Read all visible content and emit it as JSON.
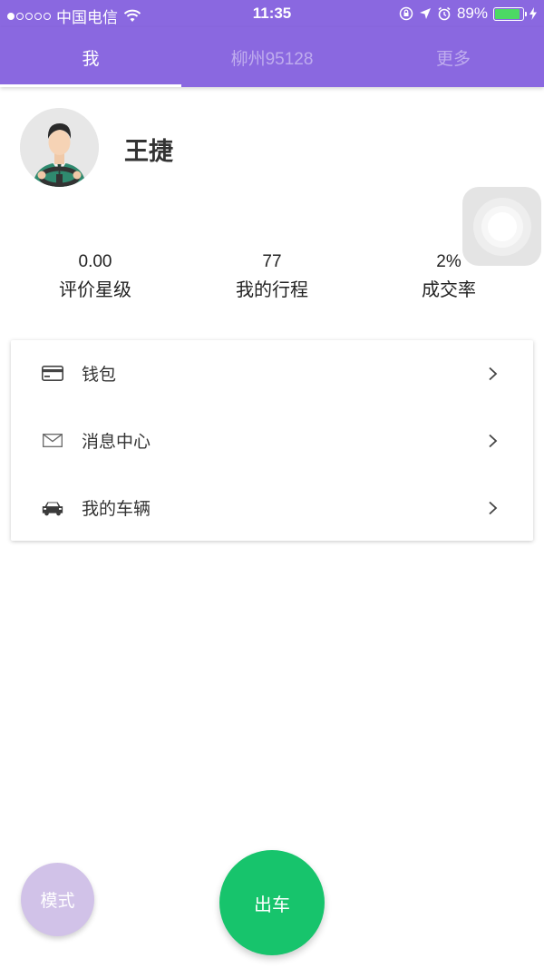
{
  "status_bar": {
    "carrier": "中国电信",
    "time": "11:35",
    "battery": "89%",
    "battery_level": 0.89,
    "signal_bars_filled": 1,
    "signal_bars_total": 5
  },
  "tabs": [
    {
      "label": "我",
      "active": true
    },
    {
      "label": "柳州95128",
      "active": false
    },
    {
      "label": "更多",
      "active": false
    }
  ],
  "profile": {
    "name": "王捷",
    "avatar_icon": "driver-avatar-icon"
  },
  "stats": [
    {
      "value": "0.00",
      "label": "评价星级"
    },
    {
      "value": "77",
      "label": "我的行程"
    },
    {
      "value": "2%",
      "label": "成交率"
    }
  ],
  "menu": [
    {
      "label": "钱包",
      "icon": "credit-card-icon"
    },
    {
      "label": "消息中心",
      "icon": "envelope-icon"
    },
    {
      "label": "我的车辆",
      "icon": "car-icon"
    }
  ],
  "actions": {
    "mode_label": "模式",
    "go_label": "出车"
  },
  "colors": {
    "header": "#8a68e0",
    "go_button": "#17c46c",
    "mode_button": "#d1c2e8",
    "battery": "#4cd964"
  }
}
